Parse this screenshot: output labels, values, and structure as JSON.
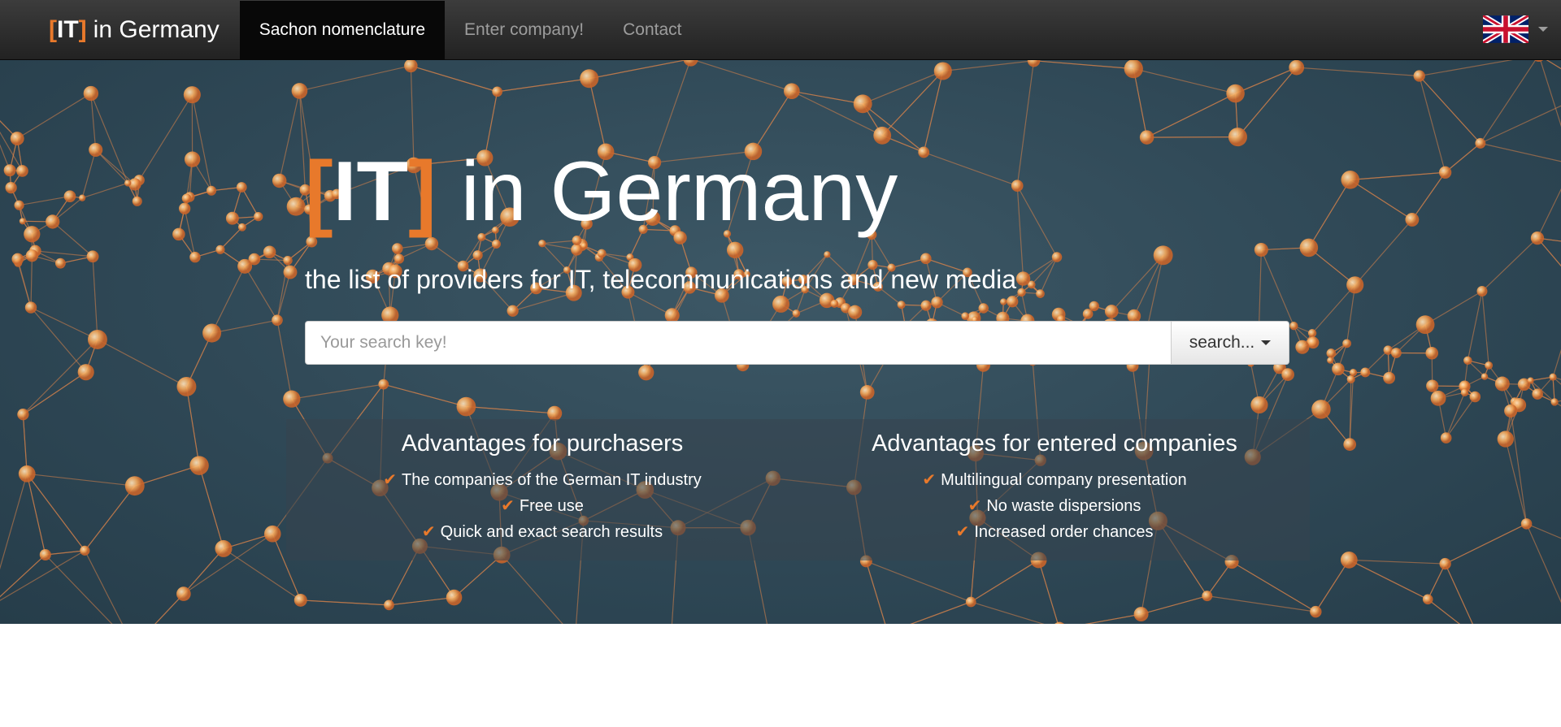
{
  "navbar": {
    "brand": {
      "bracket_open": "[",
      "it": "IT",
      "bracket_close": "]",
      "rest": "in Germany"
    },
    "items": [
      {
        "label": "Sachon nomenclature",
        "active": true
      },
      {
        "label": "Enter company!",
        "active": false
      },
      {
        "label": "Contact",
        "active": false
      }
    ],
    "language_icon": "uk-flag-icon"
  },
  "hero": {
    "title": {
      "bracket_open": "[",
      "it": "IT",
      "bracket_close": "]",
      "rest": "in Germany"
    },
    "subtitle": "the list of providers for IT, telecommunications and new media",
    "search": {
      "placeholder": "Your search key!",
      "value": "",
      "button_label": "search..."
    },
    "advantages": {
      "purchasers": {
        "heading": "Advantages for purchasers",
        "items": [
          "The companies of the German IT industry",
          "Free use",
          "Quick and exact search results"
        ]
      },
      "companies": {
        "heading": "Advantages for entered companies",
        "items": [
          "Multilingual company presentation",
          "No waste dispersions",
          "Increased order chances"
        ]
      }
    }
  },
  "colors": {
    "accent": "#e8792b",
    "navbar": "#222222",
    "hero_bg": "#2f4856",
    "node": "#f0a050"
  }
}
